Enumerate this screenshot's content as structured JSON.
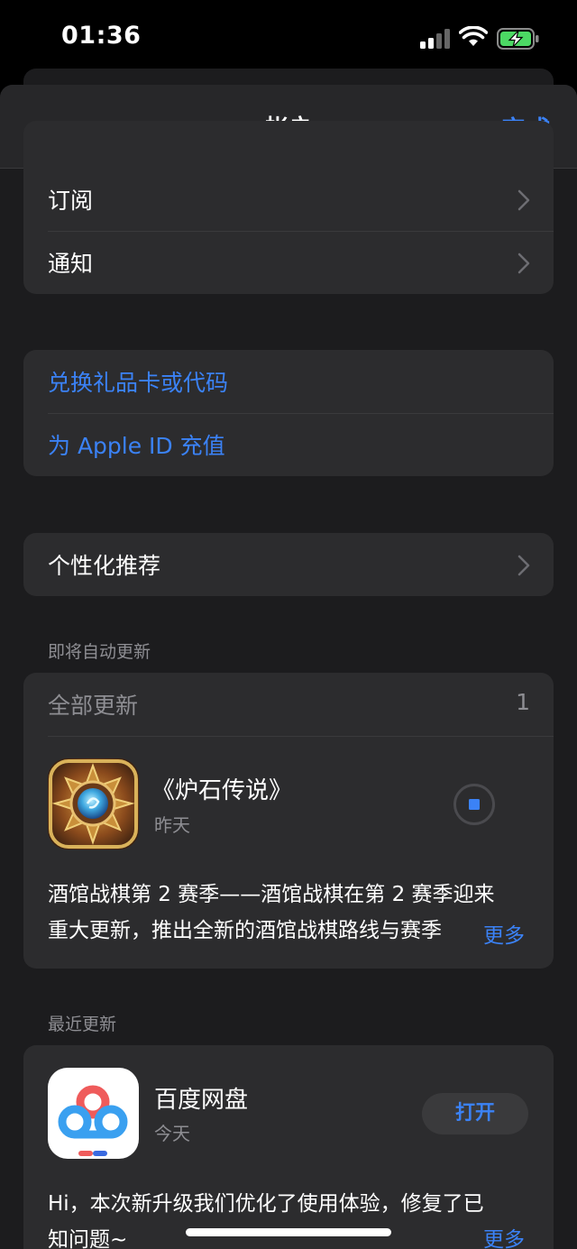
{
  "status": {
    "time": "01:36"
  },
  "nav": {
    "title": "帐户",
    "done_label": "完成"
  },
  "group1": {
    "items": [
      {
        "label": "订阅"
      },
      {
        "label": "通知"
      }
    ]
  },
  "group2": {
    "items": [
      {
        "label": "兑换礼品卡或代码"
      },
      {
        "label": "为 Apple ID 充值"
      }
    ]
  },
  "group3": {
    "label": "个性化推荐"
  },
  "upcoming": {
    "section_title": "即将自动更新",
    "update_all_label": "全部更新",
    "count": "1",
    "app": {
      "name": "《炉石传说》",
      "date": "昨天",
      "desc_line1": "酒馆战棋第 2 赛季——酒馆战棋在第 2 赛季迎来",
      "desc_line2": "重大更新，推出全新的酒馆战棋路线与赛季",
      "more_label": "更多"
    }
  },
  "recent": {
    "section_title": "最近更新",
    "app": {
      "name": "百度网盘",
      "date": "今天",
      "open_label": "打开",
      "desc_line1": "Hi，本次新升级我们优化了使用体验，修复了已",
      "desc_line2": "知问题~",
      "more_label": "更多"
    }
  },
  "colors": {
    "accent": "#3b82f6",
    "background": "#1c1c1e",
    "card": "#2c2c2e",
    "secondary_text": "#8e8e93"
  }
}
